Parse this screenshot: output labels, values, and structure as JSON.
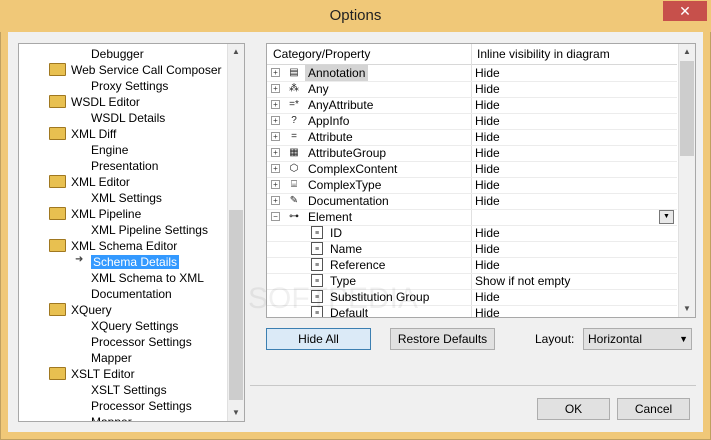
{
  "window": {
    "title": "Options",
    "close_symbol": "✕"
  },
  "tree": {
    "items": [
      {
        "label": "Debugger",
        "level": 1,
        "folder": false
      },
      {
        "label": "Web Service Call Composer",
        "level": 0,
        "folder": true
      },
      {
        "label": "Proxy Settings",
        "level": 1,
        "folder": false
      },
      {
        "label": "WSDL Editor",
        "level": 0,
        "folder": true
      },
      {
        "label": "WSDL Details",
        "level": 1,
        "folder": false
      },
      {
        "label": "XML Diff",
        "level": 0,
        "folder": true
      },
      {
        "label": "Engine",
        "level": 1,
        "folder": false
      },
      {
        "label": "Presentation",
        "level": 1,
        "folder": false
      },
      {
        "label": "XML Editor",
        "level": 0,
        "folder": true
      },
      {
        "label": "XML Settings",
        "level": 1,
        "folder": false
      },
      {
        "label": "XML Pipeline",
        "level": 0,
        "folder": true
      },
      {
        "label": "XML Pipeline Settings",
        "level": 1,
        "folder": false
      },
      {
        "label": "XML Schema Editor",
        "level": 0,
        "folder": true
      },
      {
        "label": "Schema Details",
        "level": 1,
        "folder": false,
        "selected": true
      },
      {
        "label": "XML Schema to XML",
        "level": 1,
        "folder": false
      },
      {
        "label": "Documentation",
        "level": 1,
        "folder": false
      },
      {
        "label": "XQuery",
        "level": 0,
        "folder": true
      },
      {
        "label": "XQuery Settings",
        "level": 1,
        "folder": false
      },
      {
        "label": "Processor Settings",
        "level": 1,
        "folder": false
      },
      {
        "label": "Mapper",
        "level": 1,
        "folder": false
      },
      {
        "label": "XSLT Editor",
        "level": 0,
        "folder": true
      },
      {
        "label": "XSLT Settings",
        "level": 1,
        "folder": false
      },
      {
        "label": "Processor Settings",
        "level": 1,
        "folder": false
      },
      {
        "label": "Mapper",
        "level": 1,
        "folder": false
      }
    ]
  },
  "grid": {
    "headers": [
      "Category/Property",
      "Inline visibility in diagram"
    ],
    "rows": [
      {
        "name": "Annotation",
        "value": "Hide",
        "expander": "+",
        "icon": "annotation-icon",
        "glyph": "▤",
        "selected": true
      },
      {
        "name": "Any",
        "value": "Hide",
        "expander": "+",
        "icon": "any-icon",
        "glyph": "⁂"
      },
      {
        "name": "AnyAttribute",
        "value": "Hide",
        "expander": "+",
        "icon": "any-attribute-icon",
        "glyph": "=*"
      },
      {
        "name": "AppInfo",
        "value": "Hide",
        "expander": "+",
        "icon": "appinfo-icon",
        "glyph": "?"
      },
      {
        "name": "Attribute",
        "value": "Hide",
        "expander": "+",
        "icon": "attribute-icon",
        "glyph": "="
      },
      {
        "name": "AttributeGroup",
        "value": "Hide",
        "expander": "+",
        "icon": "attribute-group-icon",
        "glyph": "▦"
      },
      {
        "name": "ComplexContent",
        "value": "Hide",
        "expander": "+",
        "icon": "complex-content-icon",
        "glyph": "⬡"
      },
      {
        "name": "ComplexType",
        "value": "Hide",
        "expander": "+",
        "icon": "complex-type-icon",
        "glyph": "⌸"
      },
      {
        "name": "Documentation",
        "value": "Hide",
        "expander": "+",
        "icon": "documentation-icon",
        "glyph": "✎"
      },
      {
        "name": "Element",
        "value": "",
        "expander": "−",
        "icon": "element-icon",
        "glyph": "⊶",
        "dropdown": true
      },
      {
        "name": "ID",
        "value": "Hide",
        "child": true,
        "icon": "property-doc-icon",
        "glyph": "≡"
      },
      {
        "name": "Name",
        "value": "Hide",
        "child": true,
        "icon": "property-doc-icon",
        "glyph": "≡"
      },
      {
        "name": "Reference",
        "value": "Hide",
        "child": true,
        "icon": "property-doc-icon",
        "glyph": "≡"
      },
      {
        "name": "Type",
        "value": "Show if not empty",
        "child": true,
        "icon": "property-doc-icon",
        "glyph": "≡"
      },
      {
        "name": "Substitution Group",
        "value": "Hide",
        "child": true,
        "icon": "property-doc-icon",
        "glyph": "≡"
      },
      {
        "name": "Default",
        "value": "Hide",
        "child": true,
        "icon": "property-doc-icon",
        "glyph": "≡"
      }
    ]
  },
  "buttons": {
    "hide_all": "Hide All",
    "restore_defaults": "Restore Defaults",
    "ok": "OK",
    "cancel": "Cancel"
  },
  "layout": {
    "label": "Layout:",
    "value": "Horizontal"
  },
  "watermark": "SOFTPEDIA"
}
